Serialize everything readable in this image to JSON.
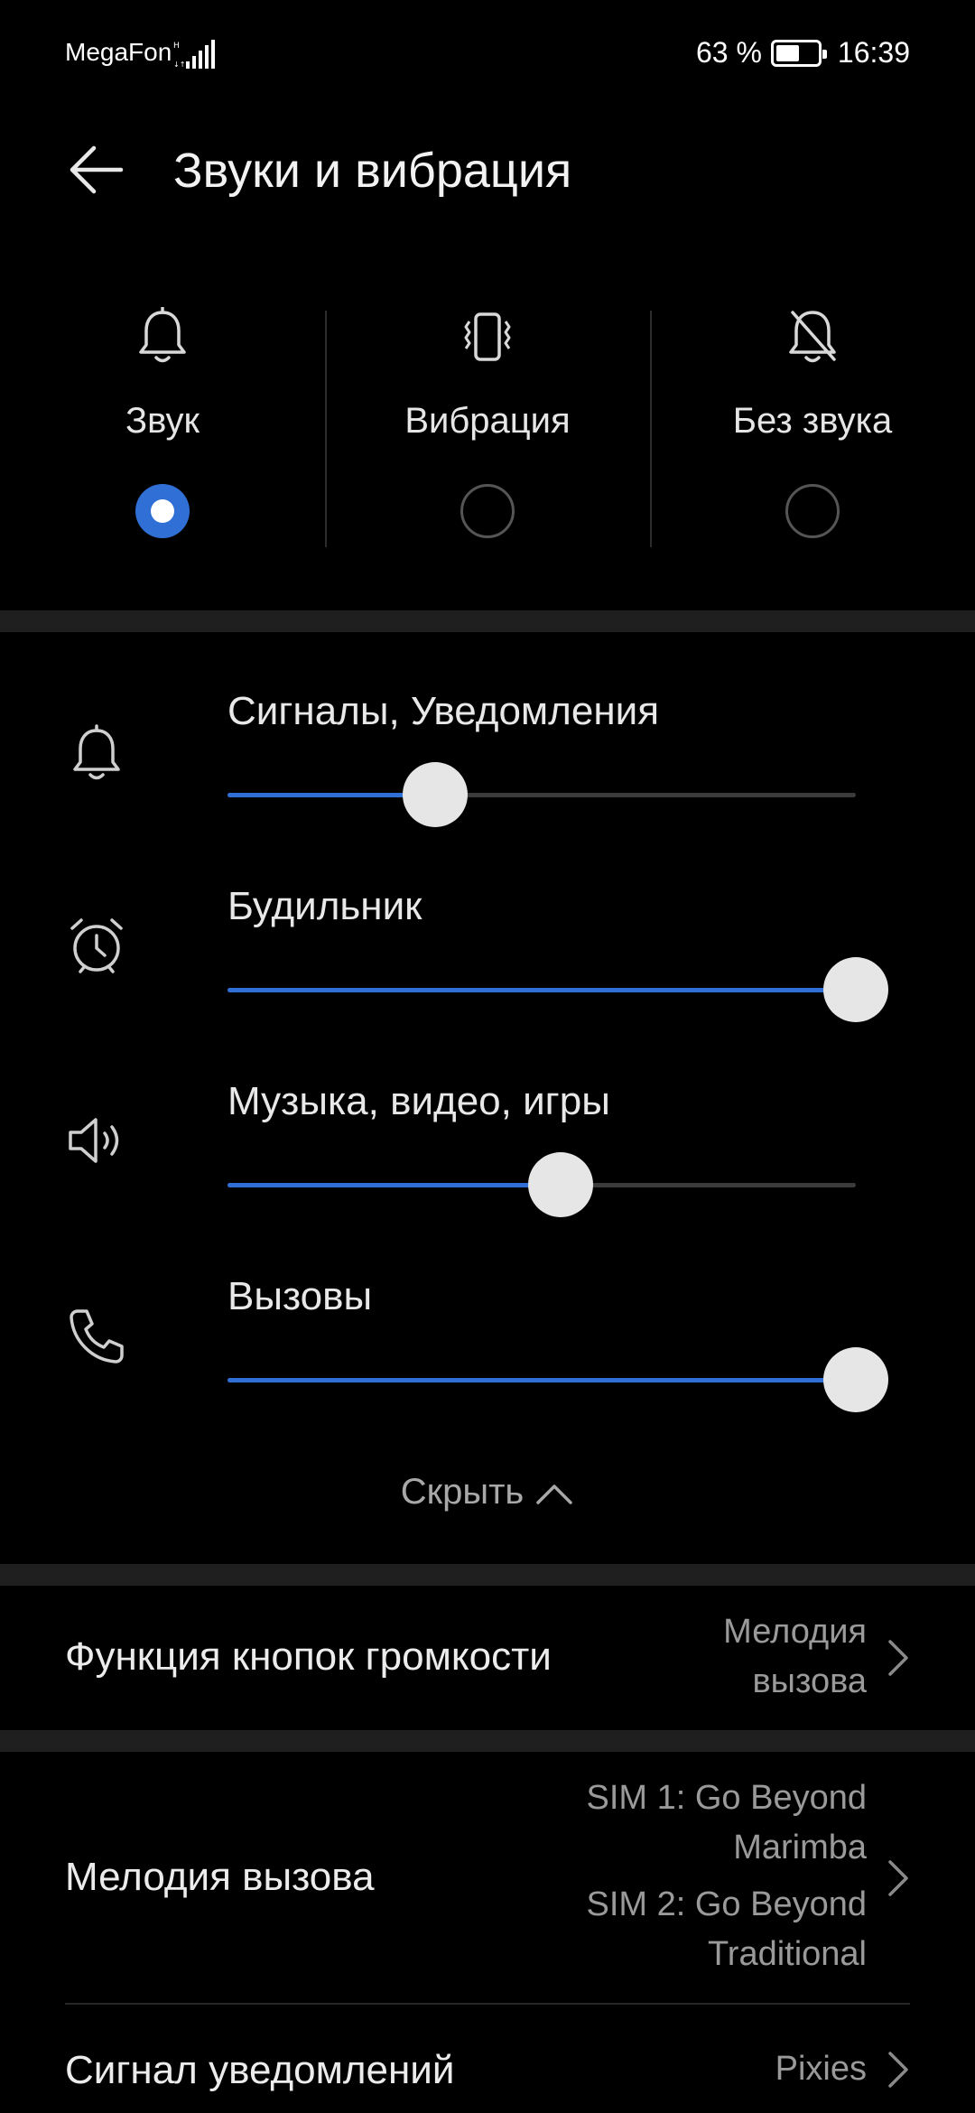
{
  "status_bar": {
    "carrier": "MegaFon",
    "battery": "63 %",
    "battery_level": 0.63,
    "time": "16:39"
  },
  "header": {
    "title": "Звуки и вибрация",
    "back_icon": "arrow-left-icon"
  },
  "modes": [
    {
      "label": "Звук",
      "icon": "bell-icon",
      "selected": true
    },
    {
      "label": "Вибрация",
      "icon": "vibrate-icon",
      "selected": false
    },
    {
      "label": "Без звука",
      "icon": "bell-off-icon",
      "selected": false
    }
  ],
  "volumes": [
    {
      "label": "Сигналы, Уведомления",
      "icon": "bell-icon",
      "level": 0.33
    },
    {
      "label": "Будильник",
      "icon": "alarm-clock-icon",
      "level": 1.0
    },
    {
      "label": "Музыка, видео, игры",
      "icon": "speaker-icon",
      "level": 0.53
    },
    {
      "label": "Вызовы",
      "icon": "phone-icon",
      "level": 1.0
    }
  ],
  "hide_label": "Скрыть",
  "accent_color": "#2f6fd6",
  "settings": [
    {
      "title": "Функция кнопок громкости",
      "value_lines": [
        "Мелодия",
        "вызова"
      ]
    },
    {
      "title": "Мелодия вызова",
      "value_lines": [
        "SIM 1: Go Beyond",
        "Marimba",
        "SIM 2: Go Beyond",
        "Traditional"
      ]
    },
    {
      "title": "Сигнал уведомлений",
      "value_lines": [
        "Pixies"
      ]
    }
  ]
}
